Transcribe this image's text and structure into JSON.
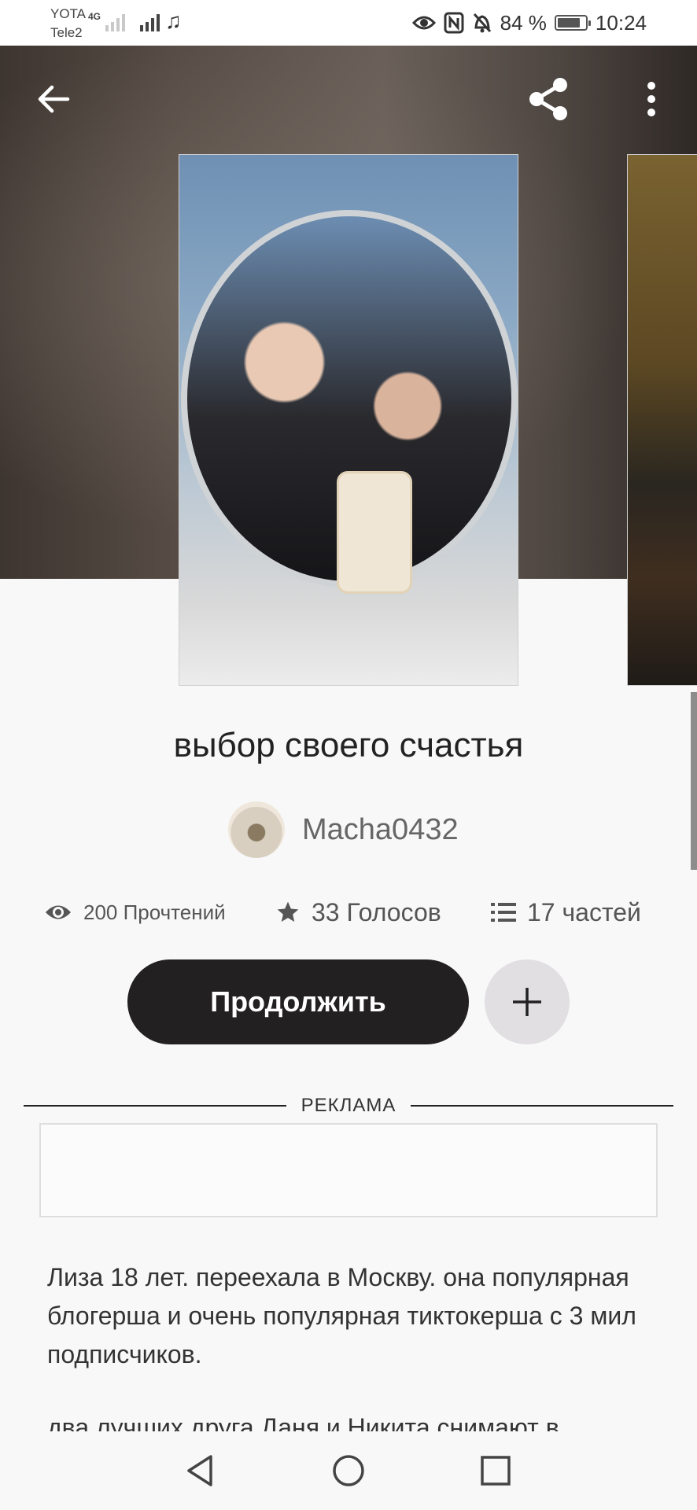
{
  "status_bar": {
    "carrier1": "YOTA",
    "carrier2": "Tele2",
    "network": "4G",
    "battery": "84 %",
    "battery_level": 0.84,
    "time": "10:24",
    "icons": [
      "eye-icon",
      "nfc-icon",
      "mute-bell-icon",
      "music-note-icon"
    ]
  },
  "header": {
    "back_icon": "arrow-left-icon",
    "share_icon": "share-icon",
    "menu_icon": "more-vertical-icon"
  },
  "story": {
    "title": "выбор своего счастья",
    "author": "Macha0432",
    "stats": {
      "reads": "200 Прочтений",
      "votes": "33 Голосов",
      "parts": "17 частей"
    },
    "continue_label": "Продолжить",
    "add_icon": "plus-icon",
    "ad_label": "РЕКЛАМА",
    "description": [
      "Лиза 18 лет. переехала в Москву. она популярная блогерша и очень популярная тиктокерша с 3 мил подписчиков.",
      "два лучших друга Даня и Никита снимают в"
    ]
  },
  "nav_bar": {
    "back": "triangle-back-icon",
    "home": "circle-home-icon",
    "recents": "square-recents-icon"
  },
  "colors": {
    "primary_button": "#232022",
    "secondary_button": "#e1dfe2",
    "background": "#f8f8f8"
  }
}
